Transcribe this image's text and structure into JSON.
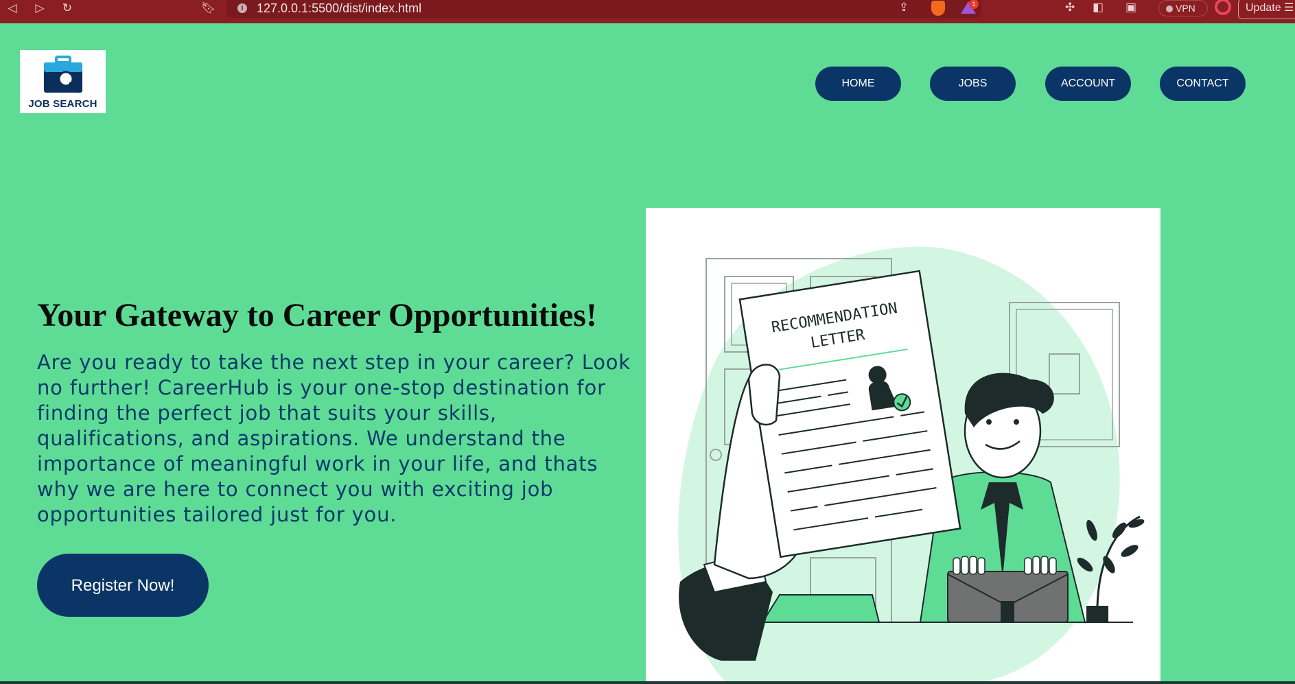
{
  "browser": {
    "url": "127.0.0.1:5500/dist/index.html",
    "vpn_label": "VPN",
    "update_label": "Update",
    "rewards_badge": "1"
  },
  "logo": {
    "text": "JOB SEARCH"
  },
  "nav": {
    "items": [
      "HOME",
      "JOBS",
      "ACCOUNT",
      "CONTACT"
    ]
  },
  "hero": {
    "title": "Your Gateway to Career Opportunities!",
    "description": "Are you ready to take the next step in your career? Look no further! CareerHub is your one-stop destination for finding the perfect job that suits your skills, qualifications, and aspirations. We understand the importance of meaningful work in your life, and thats why we are here to connect you with exciting job opportunities tailored just for you.",
    "cta_label": "Register Now!"
  },
  "illustration": {
    "letter_title_line1": "RECOMMENDATION",
    "letter_title_line2": "LETTER"
  },
  "colors": {
    "page_background": "#5edc96",
    "nav_button": "#0b3566",
    "chrome": "#8b1e22"
  }
}
